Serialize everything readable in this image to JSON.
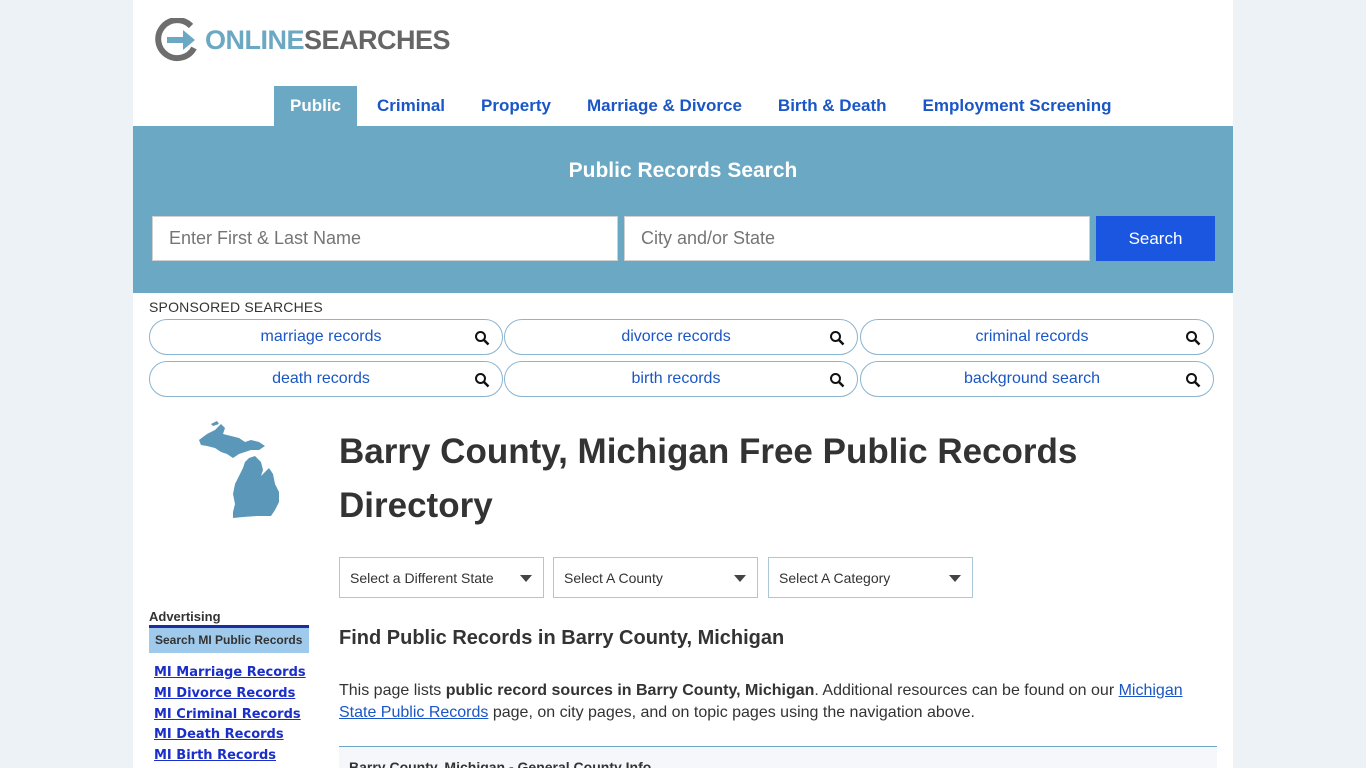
{
  "header": {
    "logo_part1": "ONLINE",
    "logo_part2": "SEARCHES",
    "logo_icon": "arrow-g-icon"
  },
  "nav": {
    "items": [
      {
        "label": "Public",
        "active": true
      },
      {
        "label": "Criminal"
      },
      {
        "label": "Property"
      },
      {
        "label": "Marriage & Divorce"
      },
      {
        "label": "Birth & Death"
      },
      {
        "label": "Employment Screening"
      }
    ]
  },
  "search": {
    "title": "Public Records Search",
    "name_placeholder": "Enter First & Last Name",
    "city_placeholder": "City and/or State",
    "button_label": "Search"
  },
  "sponsored": {
    "label": "SPONSORED SEARCHES",
    "items": [
      "marriage records",
      "divorce records",
      "criminal records",
      "death records",
      "birth records",
      "background search"
    ],
    "icon": "search-icon"
  },
  "sidebar": {
    "advertising_label": "Advertising",
    "box_title": "Search MI Public Records",
    "links": [
      "MI Marriage Records",
      "MI Divorce Records",
      "MI Criminal Records",
      "MI Death Records",
      "MI Birth Records"
    ]
  },
  "main": {
    "heading": "Barry County, Michigan Free Public Records Directory",
    "selects": [
      "Select a Different State",
      "Select A County",
      "Select A Category"
    ],
    "subheading": "Find Public Records in Barry County, Michigan",
    "intro_prefix": "This page lists ",
    "intro_bold": "public record sources in Barry County, Michigan",
    "intro_mid": ". Additional resources can be found on our ",
    "intro_link": "Michigan State Public Records",
    "intro_suffix": " page, on city pages, and on topic pages using the navigation above.",
    "info_bar": "Barry County, Michigan - General County Info"
  },
  "colors": {
    "accent": "#6aa8c4",
    "link": "#1a56c6",
    "button": "#1a56e0",
    "background": "#ecf2f5"
  }
}
